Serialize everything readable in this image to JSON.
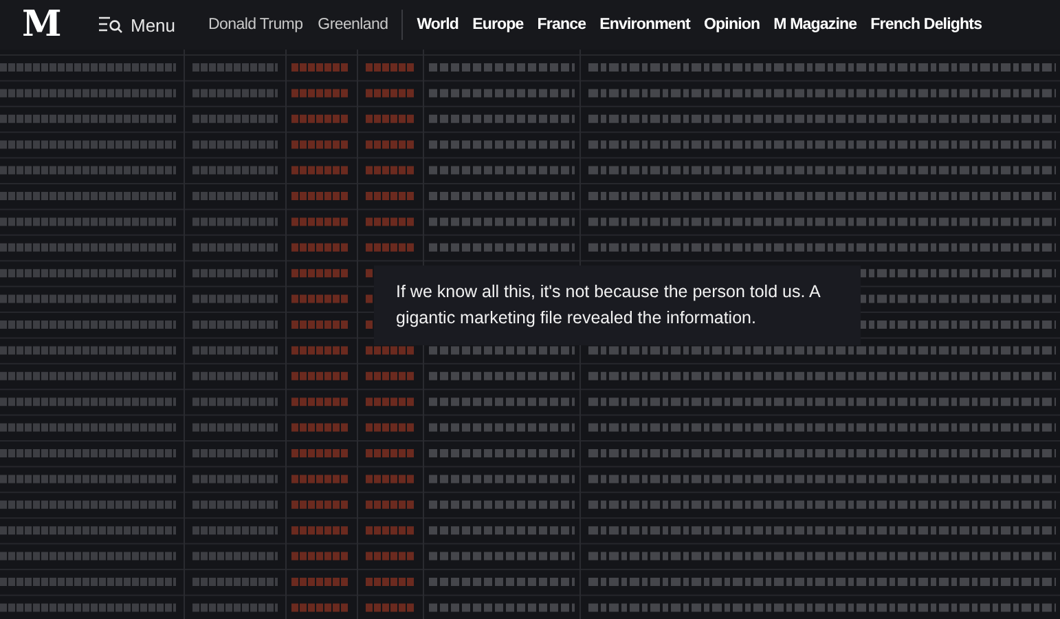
{
  "header": {
    "logo": "M",
    "menu_label": "Menu",
    "trending": [
      {
        "label": "Donald Trump"
      },
      {
        "label": "Greenland"
      }
    ],
    "sections": [
      {
        "label": "World"
      },
      {
        "label": "Europe"
      },
      {
        "label": "France"
      },
      {
        "label": "Environment"
      },
      {
        "label": "Opinion"
      },
      {
        "label": "M Magazine"
      },
      {
        "label": "French Delights"
      }
    ]
  },
  "caption": "If we know all this, it's not because the person told us. A gigantic marketing file revealed the information."
}
